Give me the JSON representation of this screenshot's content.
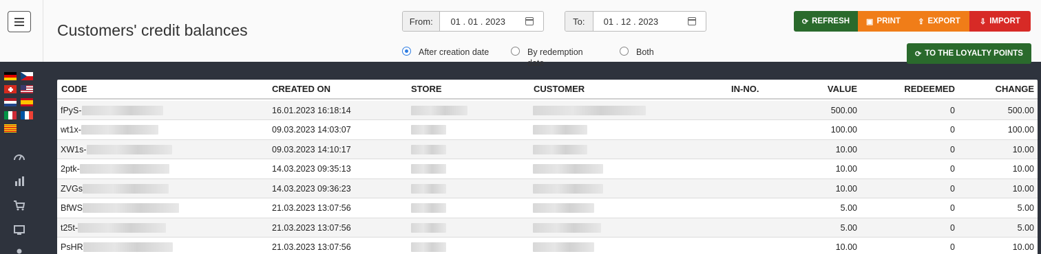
{
  "header": {
    "title": "Customers' credit balances",
    "from_label": "From:",
    "from_value": "01 . 01 . 2023",
    "to_label": "To:",
    "to_value": "01 . 12 . 2023"
  },
  "filters": [
    {
      "label": "After creation date",
      "checked": true
    },
    {
      "label": "By redemption date",
      "checked": false
    },
    {
      "label": "Both",
      "checked": false
    }
  ],
  "buttons": {
    "refresh": "REFRESH",
    "print": "PRINT",
    "export": "EXPORT",
    "import": "IMPORT",
    "loyalty": "TO THE LOYALTY POINTS"
  },
  "colors": {
    "refresh": "#2a6a2c",
    "print": "#f07d18",
    "export": "#f07d18",
    "import": "#d72a26",
    "loyalty": "#2a6a2c",
    "sidebar": "#2e333d"
  },
  "sidebar": {
    "icons": [
      "dashboard-icon",
      "chart-icon",
      "cart-icon",
      "monitor-icon",
      "user-icon"
    ],
    "flags": [
      "de",
      "cz",
      "ch",
      "us",
      "nl",
      "es",
      "it",
      "fr",
      "catalonia"
    ]
  },
  "table": {
    "columns": [
      "CODE",
      "CREATED ON",
      "STORE",
      "CUSTOMER",
      "IN-NO.",
      "VALUE",
      "REDEEMED",
      "CHANGE"
    ],
    "rows": [
      {
        "code": "fPyS-",
        "created": "16.01.2023 16:18:14",
        "in_no": "",
        "value": "500.00",
        "redeemed": "0",
        "change": "500.00"
      },
      {
        "code": "wt1x-",
        "created": "09.03.2023 14:03:07",
        "in_no": "",
        "value": "100.00",
        "redeemed": "0",
        "change": "100.00"
      },
      {
        "code": "XW1s-",
        "created": "09.03.2023 14:10:17",
        "in_no": "",
        "value": "10.00",
        "redeemed": "0",
        "change": "10.00"
      },
      {
        "code": "2ptk-",
        "created": "14.03.2023 09:35:13",
        "in_no": "",
        "value": "10.00",
        "redeemed": "0",
        "change": "10.00"
      },
      {
        "code": "ZVGs",
        "created": "14.03.2023 09:36:23",
        "in_no": "",
        "value": "10.00",
        "redeemed": "0",
        "change": "10.00"
      },
      {
        "code": "BfWS",
        "created": "21.03.2023 13:07:56",
        "in_no": "",
        "value": "5.00",
        "redeemed": "0",
        "change": "5.00"
      },
      {
        "code": "t25t-",
        "created": "21.03.2023 13:07:56",
        "in_no": "",
        "value": "5.00",
        "redeemed": "0",
        "change": "5.00"
      },
      {
        "code": "PsHR",
        "created": "21.03.2023 13:07:56",
        "in_no": "",
        "value": "10.00",
        "redeemed": "0",
        "change": "10.00"
      }
    ]
  }
}
